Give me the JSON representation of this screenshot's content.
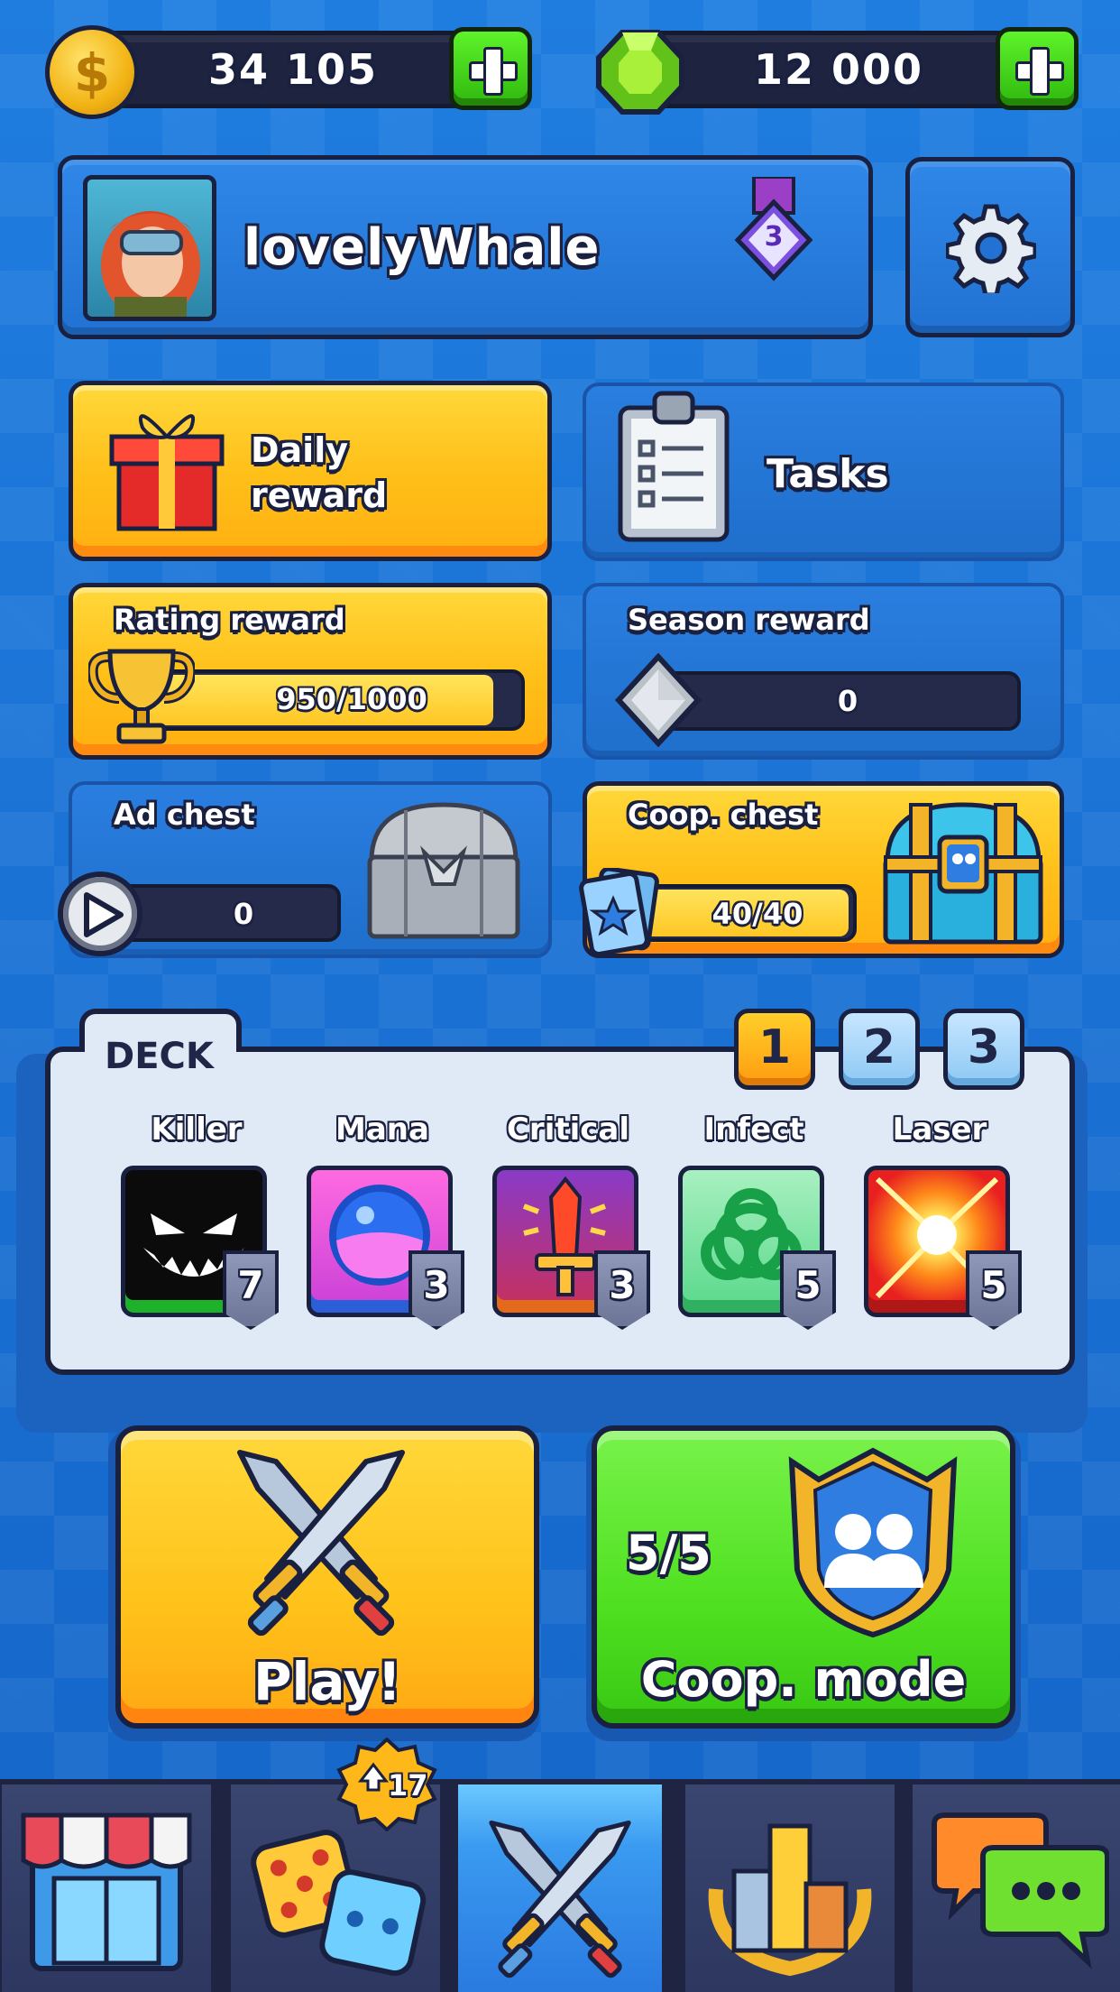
{
  "currencies": {
    "coins": "34 105",
    "gems": "12 000",
    "coin_symbol": "$",
    "coin_color": "#f2b415",
    "gem_color": "#7fd61c"
  },
  "profile": {
    "username": "lovelyWhale",
    "rank_level": "3"
  },
  "rewards": {
    "daily": "Daily reward",
    "tasks": "Tasks",
    "rating_label": "Rating reward",
    "rating_progress": "950/1000",
    "rating_fraction": 0.95,
    "season_label": "Season reward",
    "season_value": "0",
    "ad_chest_label": "Ad chest",
    "ad_chest_value": "0",
    "coop_chest_label": "Coop. chest",
    "coop_chest_progress": "40/40",
    "coop_fraction": 1.0
  },
  "deck": {
    "title": "DECK",
    "slots": [
      "1",
      "2",
      "3"
    ],
    "selected_slot": "1",
    "cards": [
      {
        "name": "Killer",
        "level": "7",
        "icon": "monster-face-icon"
      },
      {
        "name": "Mana",
        "level": "3",
        "icon": "mana-orb-icon"
      },
      {
        "name": "Critical",
        "level": "3",
        "icon": "sword-icon"
      },
      {
        "name": "Infect",
        "level": "5",
        "icon": "biohazard-icon"
      },
      {
        "name": "Laser",
        "level": "5",
        "icon": "laser-burst-icon"
      }
    ]
  },
  "modes": {
    "play": "Play!",
    "coop": "Coop. mode",
    "coop_count": "5/5"
  },
  "nav": {
    "dice_upgrades": "17",
    "items": [
      "shop-icon",
      "dice-icon",
      "battle-icon",
      "leaderboard-icon",
      "chat-icon"
    ],
    "active": "battle-icon"
  },
  "colors": {
    "accent_yellow": "#ffc01a",
    "accent_green": "#3fe01a",
    "bg_blue": "#1a6fd1",
    "outline": "#1a2040"
  }
}
